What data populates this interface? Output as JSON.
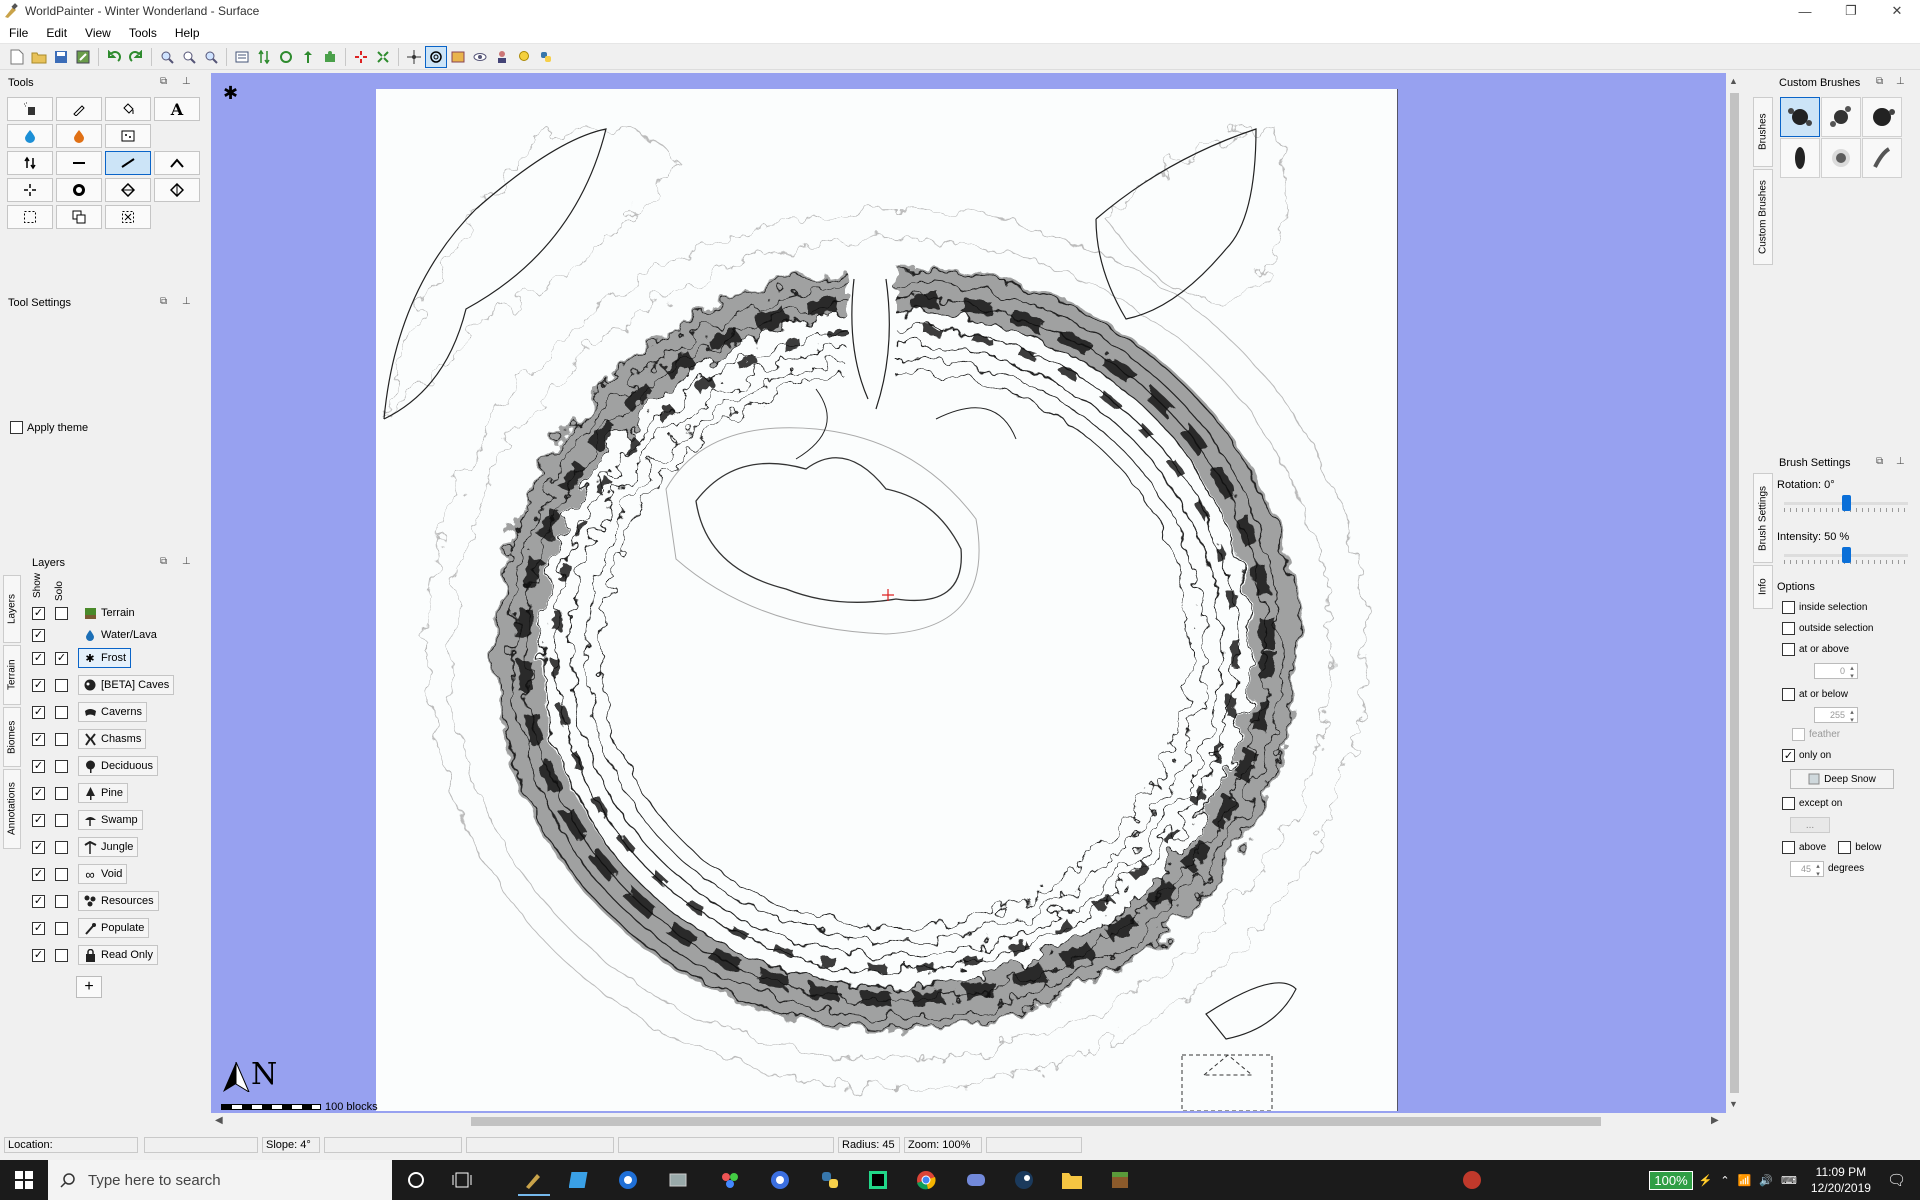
{
  "window": {
    "title": "WorldPainter - Winter Wonderland - Surface",
    "controls": {
      "minimize": "—",
      "restore": "❐",
      "close": "✕"
    }
  },
  "menu": [
    "File",
    "Edit",
    "View",
    "Tools",
    "Help"
  ],
  "panels": {
    "tools": {
      "title": "Tools"
    },
    "tool_settings": {
      "title": "Tool Settings",
      "apply_theme": "Apply theme",
      "apply_theme_checked": false
    },
    "layers": {
      "title": "Layers",
      "col_show": "Show",
      "col_solo": "Solo",
      "side_tabs": [
        "Layers",
        "Terrain",
        "Biomes",
        "Annotations"
      ],
      "items": [
        {
          "label": "Terrain",
          "icon": "terrain-icon",
          "show": true,
          "solo": false,
          "plain": true
        },
        {
          "label": "Water/Lava",
          "icon": "water-icon",
          "show": true,
          "solo": null,
          "plain": true
        },
        {
          "label": "Frost",
          "icon": "frost-icon",
          "show": true,
          "solo": true,
          "selected": true
        },
        {
          "label": "[BETA] Caves",
          "icon": "caves-icon",
          "show": true,
          "solo": false
        },
        {
          "label": "Caverns",
          "icon": "caverns-icon",
          "show": true,
          "solo": false
        },
        {
          "label": "Chasms",
          "icon": "chasms-icon",
          "show": true,
          "solo": false
        },
        {
          "label": "Deciduous",
          "icon": "deciduous-icon",
          "show": true,
          "solo": false
        },
        {
          "label": "Pine",
          "icon": "pine-icon",
          "show": true,
          "solo": false
        },
        {
          "label": "Swamp",
          "icon": "swamp-icon",
          "show": true,
          "solo": false
        },
        {
          "label": "Jungle",
          "icon": "jungle-icon",
          "show": true,
          "solo": false
        },
        {
          "label": "Void",
          "icon": "void-icon",
          "show": true,
          "solo": false
        },
        {
          "label": "Resources",
          "icon": "resources-icon",
          "show": true,
          "solo": false
        },
        {
          "label": "Populate",
          "icon": "populate-icon",
          "show": true,
          "solo": false
        },
        {
          "label": "Read Only",
          "icon": "lock-icon",
          "show": true,
          "solo": false
        }
      ],
      "add_label": "+"
    },
    "custom_brushes": {
      "title": "Custom Brushes",
      "side_tabs": [
        "Brushes",
        "Custom Brushes"
      ]
    },
    "brush_settings": {
      "title": "Brush Settings",
      "side_tabs": [
        "Brush Settings",
        "Info"
      ],
      "rotation_label": "Rotation: 0°",
      "rotation_value": 0.5,
      "intensity_label": "Intensity: 50 %",
      "intensity_value": 0.5,
      "options_label": "Options",
      "inside_selection": "inside selection",
      "outside_selection": "outside selection",
      "at_or_above": "at or above",
      "at_or_above_value": "0",
      "at_or_below": "at or below",
      "at_or_below_value": "255",
      "feather": "feather",
      "only_on": "only on",
      "only_on_checked": true,
      "only_on_value": "Deep Snow",
      "except_on": "except on",
      "except_on_value": "...",
      "above": "above",
      "below": "below",
      "degrees_value": "45",
      "degrees": "degrees"
    }
  },
  "map": {
    "scale_label": "100 blocks",
    "north_label": "N"
  },
  "status": {
    "location": "Location:",
    "slope": "Slope: 4°",
    "radius": "Radius: 45",
    "zoom": "Zoom: 100%"
  },
  "taskbar": {
    "search_placeholder": "Type here to search",
    "battery": "100%",
    "time": "11:09 PM",
    "date": "12/20/2019"
  },
  "colors": {
    "map_background": "#97a1f0",
    "accent": "#0a64c8",
    "taskbar": "#1b1b1b"
  }
}
